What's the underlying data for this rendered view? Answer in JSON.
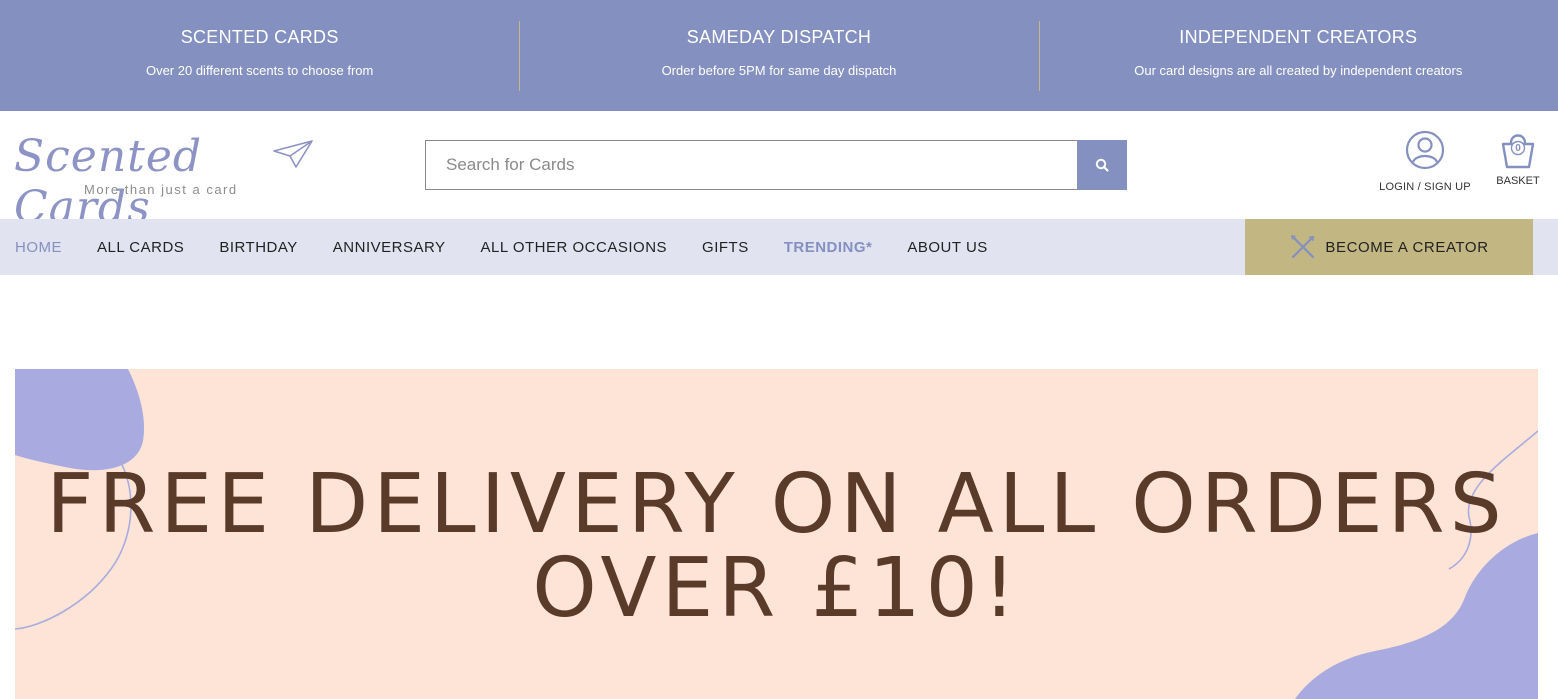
{
  "topbar": {
    "items": [
      {
        "title": "SCENTED CARDS",
        "subtitle": "Over 20 different scents to choose from"
      },
      {
        "title": "SAMEDAY DISPATCH",
        "subtitle": "Order before 5PM for same day dispatch"
      },
      {
        "title": "INDEPENDENT CREATORS",
        "subtitle": "Our card designs are all created by independent creators"
      }
    ]
  },
  "header": {
    "logo_text": "Scented Cards",
    "logo_tagline": "More than just a card",
    "search_placeholder": "Search for Cards",
    "account_label": "LOGIN / SIGN UP",
    "basket_label": "BASKET",
    "basket_count": "0"
  },
  "nav": {
    "items": [
      {
        "label": "HOME"
      },
      {
        "label": "ALL CARDS"
      },
      {
        "label": "BIRTHDAY"
      },
      {
        "label": "ANNIVERSARY"
      },
      {
        "label": "ALL OTHER OCCASIONS"
      },
      {
        "label": "GIFTS"
      },
      {
        "label": "TRENDING*"
      },
      {
        "label": "ABOUT US"
      }
    ],
    "creator_label": "BECOME A CREATOR"
  },
  "banner": {
    "line1": "FREE DELIVERY ON ALL ORDERS",
    "line2": "OVER £10!"
  },
  "colors": {
    "accent": "#8490bf",
    "nav_bg": "#e1e4f0",
    "creator_gold": "#c2b682",
    "banner_bg": "#fde4d6",
    "banner_text": "#5a3a28",
    "blob": "#a9abe0"
  }
}
